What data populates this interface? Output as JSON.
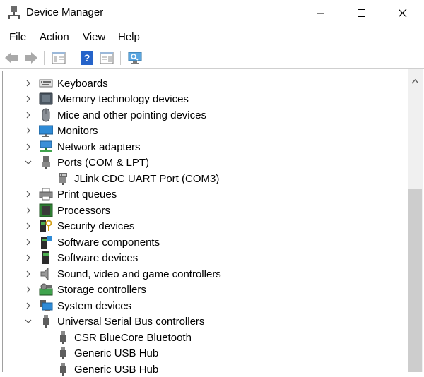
{
  "window": {
    "title": "Device Manager"
  },
  "menu": {
    "file": "File",
    "action": "Action",
    "view": "View",
    "help": "Help"
  },
  "tree": {
    "keyboards": "Keyboards",
    "memory": "Memory technology devices",
    "mice": "Mice and other pointing devices",
    "monitors": "Monitors",
    "network": "Network adapters",
    "ports": "Ports (COM & LPT)",
    "jlink": "JLink CDC UART Port (COM3)",
    "print": "Print queues",
    "processors": "Processors",
    "security": "Security devices",
    "software_components": "Software components",
    "software_devices": "Software devices",
    "sound": "Sound, video and game controllers",
    "storage": "Storage controllers",
    "system": "System devices",
    "usb": "Universal Serial Bus controllers",
    "csr": "CSR BlueCore Bluetooth",
    "hub1": "Generic USB Hub",
    "hub2": "Generic USB Hub"
  },
  "colors": {
    "monitor": "#2f8bd6",
    "board": "#2e7d32",
    "chip": "#3a3a3a",
    "help": "#2563c9"
  }
}
